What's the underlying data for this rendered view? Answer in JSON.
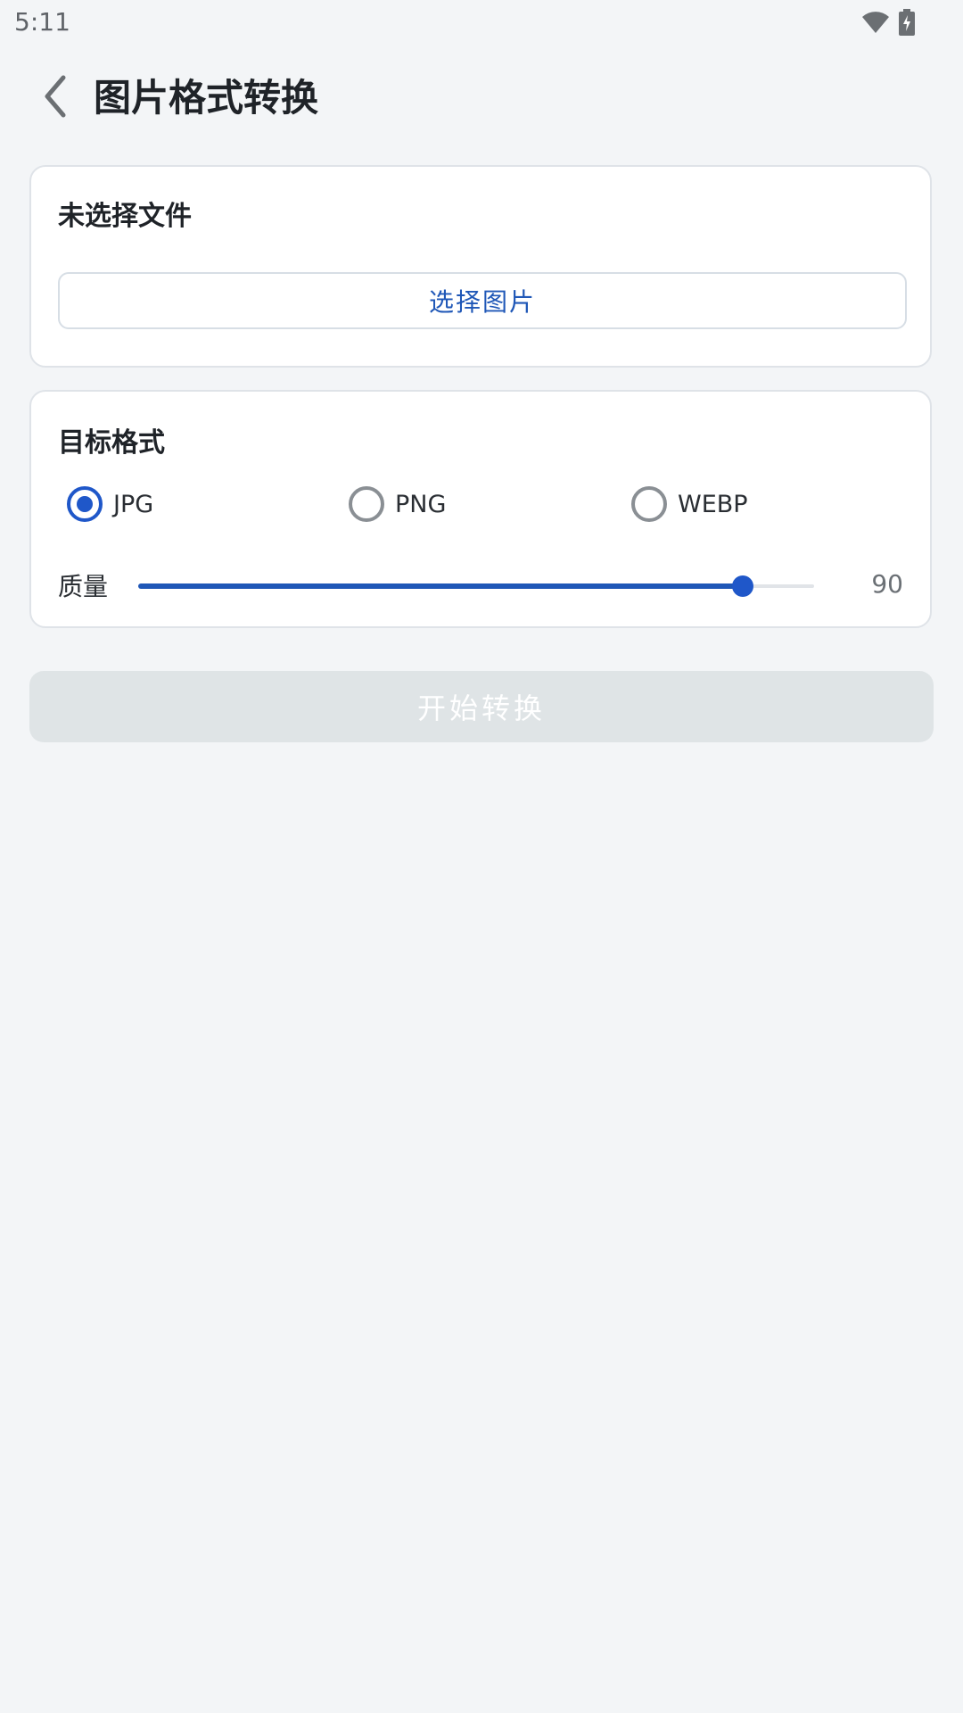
{
  "status_bar": {
    "time": "5:11",
    "icons": [
      "wifi-icon",
      "battery-charging-icon"
    ]
  },
  "app_bar": {
    "title": "图片格式转换",
    "back_icon": "chevron-left-icon"
  },
  "file_card": {
    "status": "未选择文件",
    "select_button": "选择图片"
  },
  "format_card": {
    "title": "目标格式",
    "options": [
      {
        "label": "JPG",
        "selected": true
      },
      {
        "label": "PNG",
        "selected": false
      },
      {
        "label": "WEBP",
        "selected": false
      }
    ],
    "quality_label": "质量",
    "quality_value": "90",
    "quality_fraction": 0.895
  },
  "start_button": {
    "label": "开始转换",
    "enabled": false
  },
  "colors": {
    "accent": "#1f57c9",
    "background": "#f3f5f7",
    "disabled_button": "#dfe4e6"
  }
}
